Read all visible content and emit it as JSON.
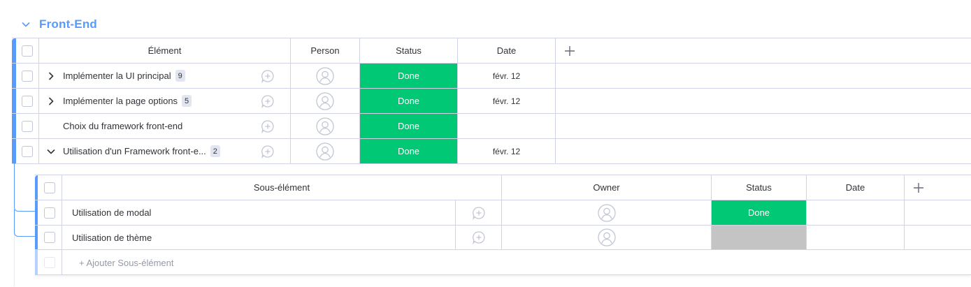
{
  "group": {
    "title": "Front-End",
    "color": "#579bfc",
    "chevron_icon": "chevron-down-icon"
  },
  "main_table": {
    "columns": {
      "element": "Élément",
      "person": "Person",
      "status": "Status",
      "date": "Date",
      "add": "+"
    },
    "rows": [
      {
        "name": "Implémenter la UI principal",
        "count": "9",
        "expander": "chevron-right-icon",
        "status": "Done",
        "date": "févr. 12"
      },
      {
        "name": "Implémenter la page options",
        "count": "5",
        "expander": "chevron-right-icon",
        "status": "Done",
        "date": "févr. 12"
      },
      {
        "name": "Choix du framework front-end",
        "count": "",
        "expander": "",
        "status": "Done",
        "date": ""
      },
      {
        "name": "Utilisation d'un Framework front-e...",
        "count": "2",
        "expander": "chevron-down-icon",
        "status": "Done",
        "date": "févr. 12"
      }
    ]
  },
  "sub_table": {
    "columns": {
      "subitem": "Sous-élément",
      "owner": "Owner",
      "status": "Status",
      "date": "Date",
      "add": "+"
    },
    "rows": [
      {
        "name": "Utilisation de modal",
        "status": "Done",
        "date": ""
      },
      {
        "name": "Utilisation de thème",
        "status": "",
        "date": ""
      }
    ],
    "add_label": "+ Ajouter Sous-élément"
  },
  "colors": {
    "done": "#00c875",
    "empty_status": "#c4c4c4",
    "accent": "#579bfc",
    "border": "#d0d4e4"
  }
}
